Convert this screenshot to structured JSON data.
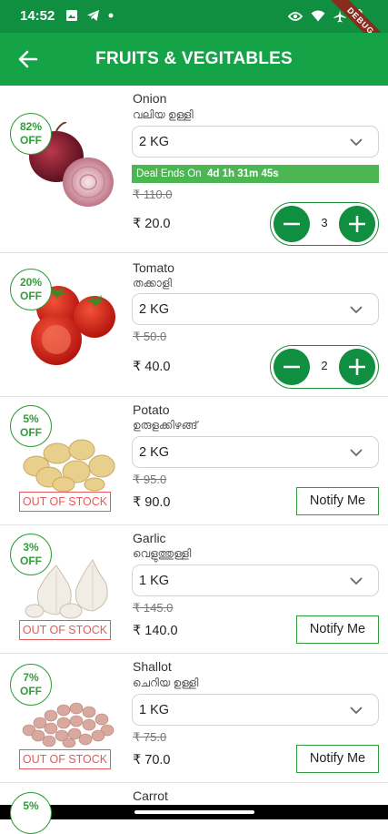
{
  "status_bar": {
    "time": "14:52"
  },
  "debug_banner": "DEBUG",
  "header": {
    "title": "FRUITS & VEGITABLES"
  },
  "products": [
    {
      "name": "Onion",
      "local_name": "വലിയ ഉള്ളി",
      "discount_pct": "82%",
      "off_label": "OFF",
      "unit": "2 KG",
      "deal_label": "Deal Ends On",
      "deal_timer": "4d 1h 31m 45s",
      "mrp": "₹ 110.0",
      "price": "₹ 20.0",
      "quantity": "3"
    },
    {
      "name": "Tomato",
      "local_name": "തക്കാളി",
      "discount_pct": "20%",
      "off_label": "OFF",
      "unit": "2 KG",
      "mrp": "₹ 50.0",
      "price": "₹ 40.0",
      "quantity": "2"
    },
    {
      "name": "Potato",
      "local_name": "ഉരുളക്കിഴങ്ങ്",
      "discount_pct": "5%",
      "off_label": "OFF",
      "unit": "2 KG",
      "mrp": "₹ 95.0",
      "price": "₹ 90.0",
      "stock_label": "OUT OF STOCK",
      "notify_label": "Notify Me"
    },
    {
      "name": "Garlic",
      "local_name": "വെളുത്തുള്ളി",
      "discount_pct": "3%",
      "off_label": "OFF",
      "unit": "1 KG",
      "mrp": "₹ 145.0",
      "price": "₹ 140.0",
      "stock_label": "OUT OF STOCK",
      "notify_label": "Notify Me"
    },
    {
      "name": "Shallot",
      "local_name": "ചെറിയ ഉള്ളി",
      "discount_pct": "7%",
      "off_label": "OFF",
      "unit": "1 KG",
      "mrp": "₹ 75.0",
      "price": "₹ 70.0",
      "stock_label": "OUT OF STOCK",
      "notify_label": "Notify Me"
    },
    {
      "name": "Carrot",
      "discount_pct": "5%"
    }
  ],
  "colors": {
    "status_bar": "#0f8f3f",
    "app_bar": "#15a348",
    "accent": "#2f9e3a",
    "out_of_stock": "#e45a5a",
    "deal_bar": "#4cb752"
  }
}
